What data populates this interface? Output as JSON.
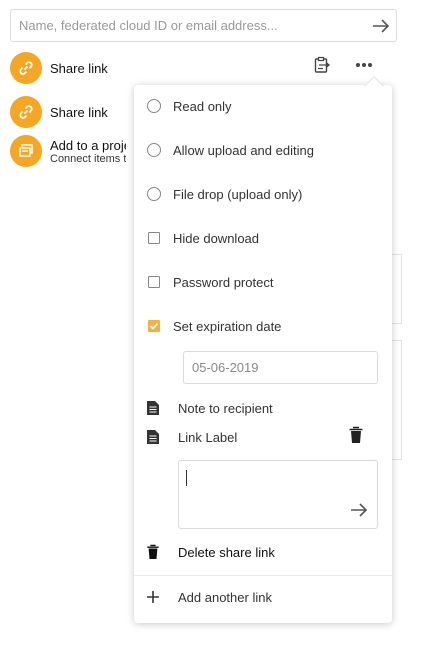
{
  "search": {
    "placeholder": "Name, federated cloud ID or email address..."
  },
  "shares": [
    {
      "title": "Share link"
    },
    {
      "title": "Share link"
    }
  ],
  "project": {
    "title": "Add to a project",
    "subtitle": "Connect items to a project"
  },
  "menu": {
    "read_only": "Read only",
    "allow_upload": "Allow upload and editing",
    "file_drop": "File drop (upload only)",
    "hide_download": "Hide download",
    "password_protect": "Password protect",
    "set_expiration": "Set expiration date",
    "expiration_date": "05-06-2019",
    "note_to_recipient": "Note to recipient",
    "link_label": "Link Label",
    "delete_share": "Delete share link",
    "add_another": "Add another link"
  },
  "state": {
    "expiration_checked": true
  },
  "colors": {
    "accent": "#f5a623",
    "checkbox": "#f5b13d"
  },
  "icons": {
    "send": "arrow-right-icon",
    "link": "link-icon",
    "clipboard": "clipboard-icon",
    "more": "more-icon",
    "project": "project-icon",
    "note": "document-icon",
    "trash": "trash-icon",
    "add": "plus-icon"
  }
}
